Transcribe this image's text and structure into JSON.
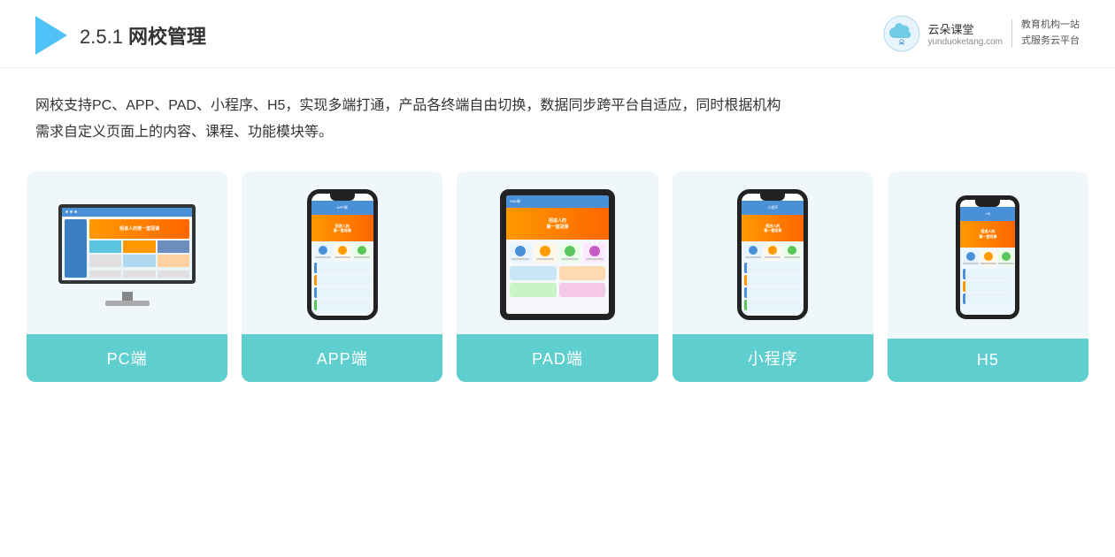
{
  "header": {
    "section_number": "2.5.1",
    "title_plain": "2.5.1 ",
    "title_bold": "网校管理"
  },
  "brand": {
    "name": "云朵课堂",
    "url": "yunduoketang.com",
    "slogan_line1": "教育机构一站",
    "slogan_line2": "式服务云平台"
  },
  "description": {
    "line1": "网校支持PC、APP、PAD、小程序、H5，实现多端打通，产品各终端自由切换，数据同步跨平台自适应，同时根据机构",
    "line2": "需求自定义页面上的内容、课程、功能模块等。"
  },
  "cards": [
    {
      "id": "pc",
      "label": "PC端"
    },
    {
      "id": "app",
      "label": "APP端"
    },
    {
      "id": "pad",
      "label": "PAD端"
    },
    {
      "id": "miniapp",
      "label": "小程序"
    },
    {
      "id": "h5",
      "label": "H5"
    }
  ],
  "colors": {
    "card_bg": "#eef6fb",
    "card_label": "#5ecece",
    "accent_blue": "#4a90d9",
    "accent_orange": "#ff9900",
    "header_border": "#eeeeee"
  }
}
